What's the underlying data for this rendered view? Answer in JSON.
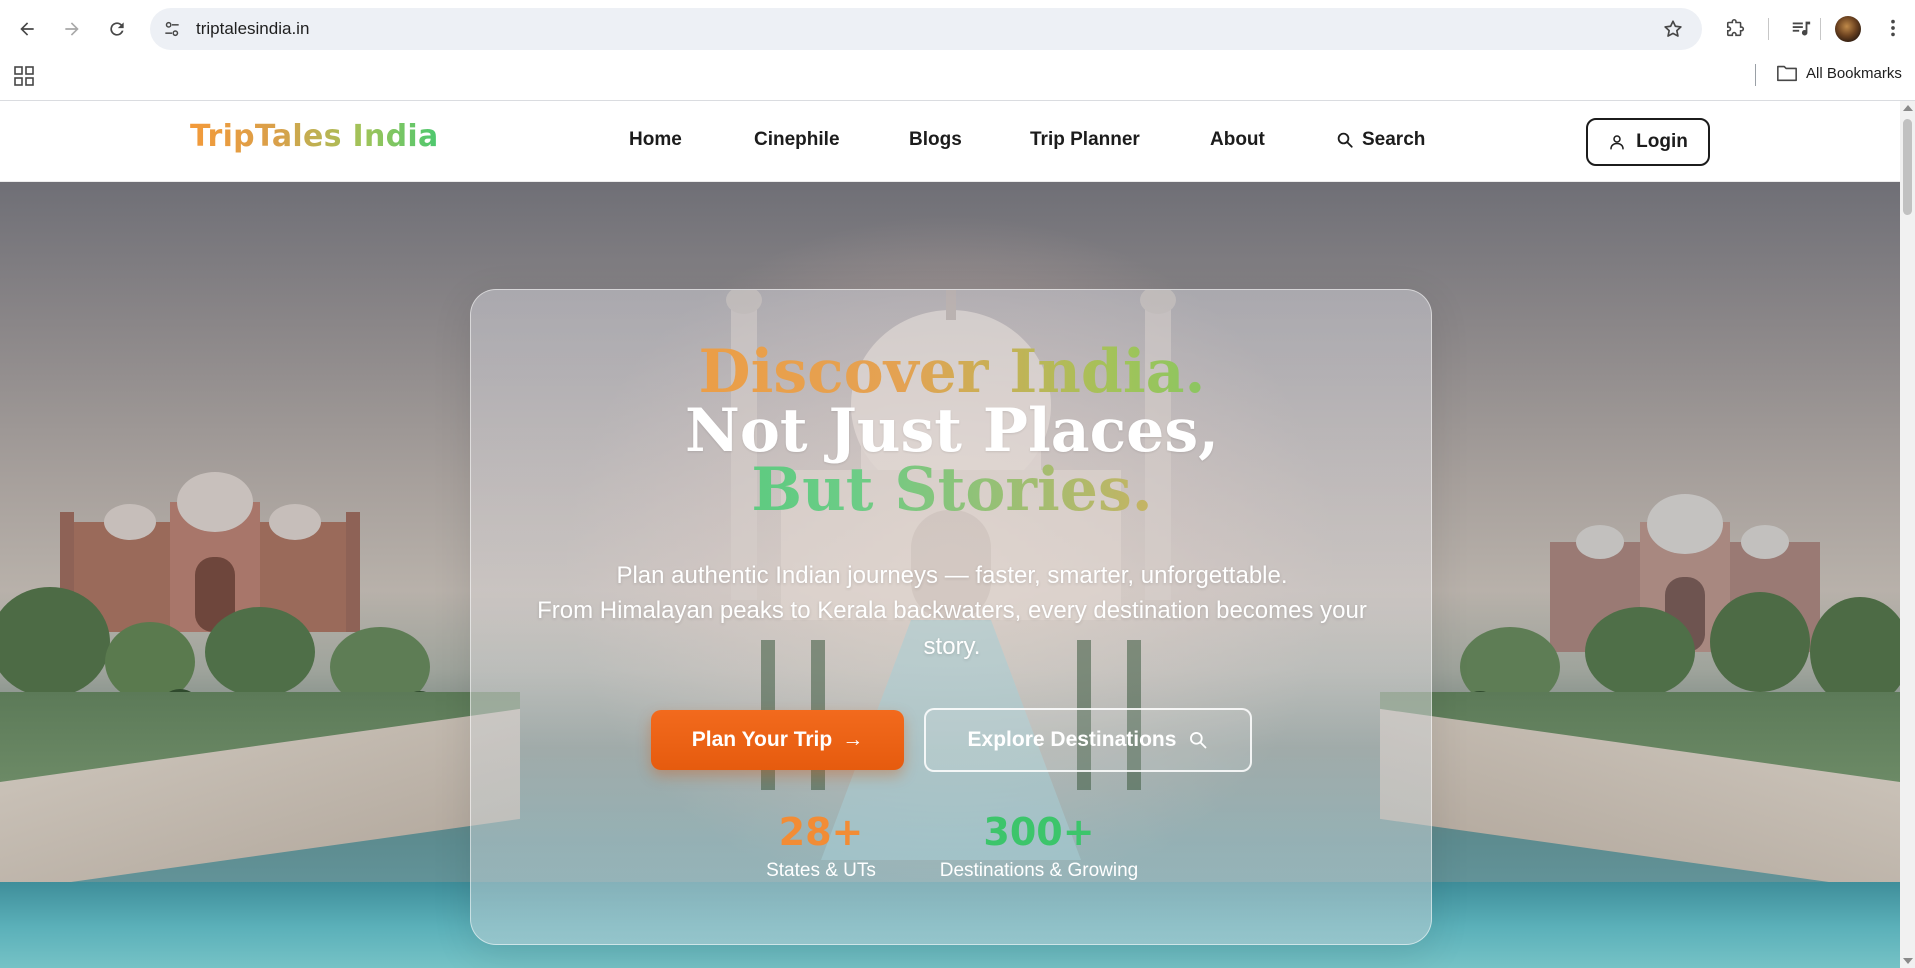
{
  "browser": {
    "url": "triptalesindia.in",
    "bookmarks_label": "All Bookmarks"
  },
  "site": {
    "logo": "TripTales India",
    "nav": {
      "home": "Home",
      "cinephile": "Cinephile",
      "blogs": "Blogs",
      "trip_planner": "Trip Planner",
      "about": "About",
      "search": "Search"
    },
    "login": "Login"
  },
  "hero": {
    "headline_1": "Discover India.",
    "headline_2": "Not Just Places,",
    "headline_3": "But Stories.",
    "subtitle_1": "Plan authentic Indian journeys — faster, smarter, unforgettable.",
    "subtitle_2": "From Himalayan peaks to Kerala backwaters, every destination becomes your story.",
    "cta_primary": "Plan Your Trip",
    "cta_primary_arrow": "→",
    "cta_secondary": "Explore Destinations",
    "stats": [
      {
        "value": "28+",
        "label": "States & UTs",
        "color": "#f28c35"
      },
      {
        "value": "300+",
        "label": "Destinations & Growing",
        "color": "#3cc56b"
      }
    ]
  },
  "colors": {
    "accent_orange": "#f26a1d",
    "accent_green": "#3cc56b"
  }
}
